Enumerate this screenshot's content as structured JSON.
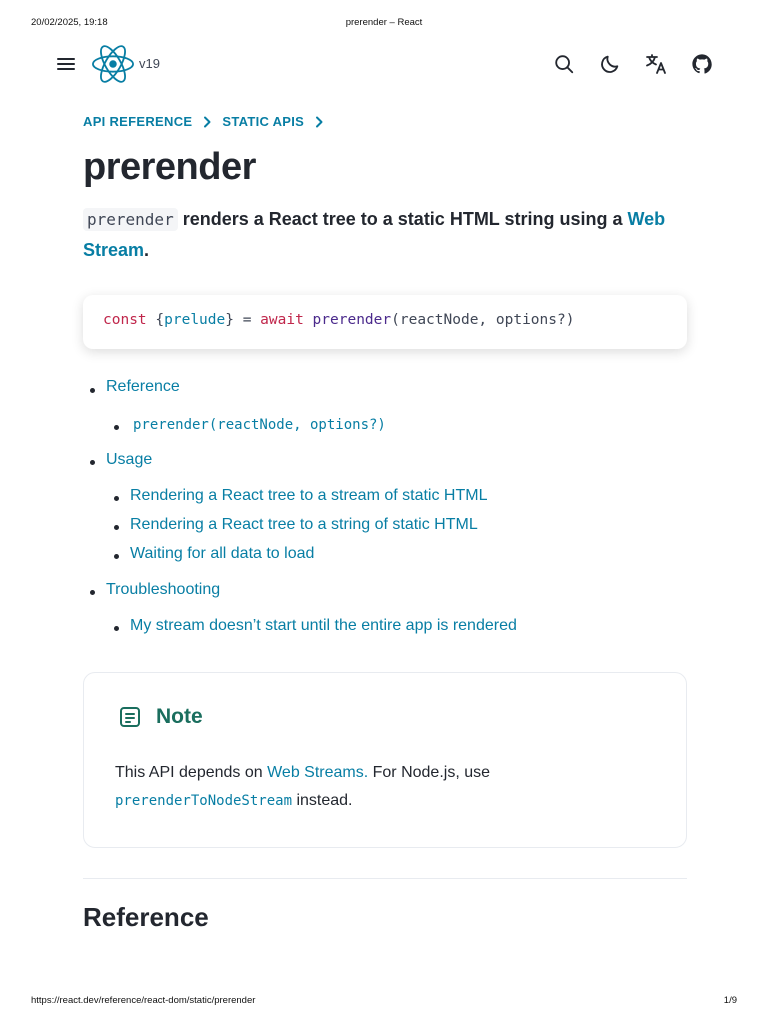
{
  "print_header": {
    "date": "20/02/2025, 19:18",
    "title": "prerender – React"
  },
  "print_footer": {
    "url": "https://react.dev/reference/react-dom/static/prerender",
    "page": "1/9"
  },
  "nav": {
    "version": "v19",
    "icons": [
      "menu-icon",
      "react-logo",
      "search-icon",
      "moon-icon",
      "translate-icon",
      "github-icon"
    ]
  },
  "breadcrumb": [
    "API REFERENCE",
    "STATIC APIS"
  ],
  "title": "prerender",
  "intro": {
    "code": "prerender",
    "text": " renders a React tree to a static HTML string using a ",
    "link": "Web Stream",
    "end": "."
  },
  "code_signature": {
    "kw1": "const",
    "brace_open": " {",
    "var": "prelude",
    "brace_close": "} = ",
    "kw2": "await",
    "sp": " ",
    "fn": "prerender",
    "args": "(reactNode, options?)"
  },
  "toc": [
    {
      "label": "Reference",
      "level": 1,
      "code": false
    },
    {
      "label": "prerender(reactNode, options?)",
      "level": 2,
      "code": true
    },
    {
      "label": "Usage",
      "level": 1,
      "code": false
    },
    {
      "label": "Rendering a React tree to a stream of static HTML",
      "level": 2,
      "code": false
    },
    {
      "label": "Rendering a React tree to a string of static HTML",
      "level": 2,
      "code": false
    },
    {
      "label": "Waiting for all data to load",
      "level": 2,
      "code": false
    },
    {
      "label": "Troubleshooting",
      "level": 1,
      "code": false
    },
    {
      "label": "My stream doesn’t start until the entire app is rendered",
      "level": 2,
      "code": false
    }
  ],
  "note": {
    "title": "Note",
    "text_before": "This API depends on ",
    "link": "Web Streams.",
    "text_mid": " For Node.js, use",
    "code": "prerenderToNodeStream",
    "text_after": " instead."
  },
  "section_heading": "Reference",
  "colors": {
    "link": "#087ea4",
    "note_title": "#1a6e5e",
    "text": "#23272f",
    "keyword": "#c0264b"
  }
}
